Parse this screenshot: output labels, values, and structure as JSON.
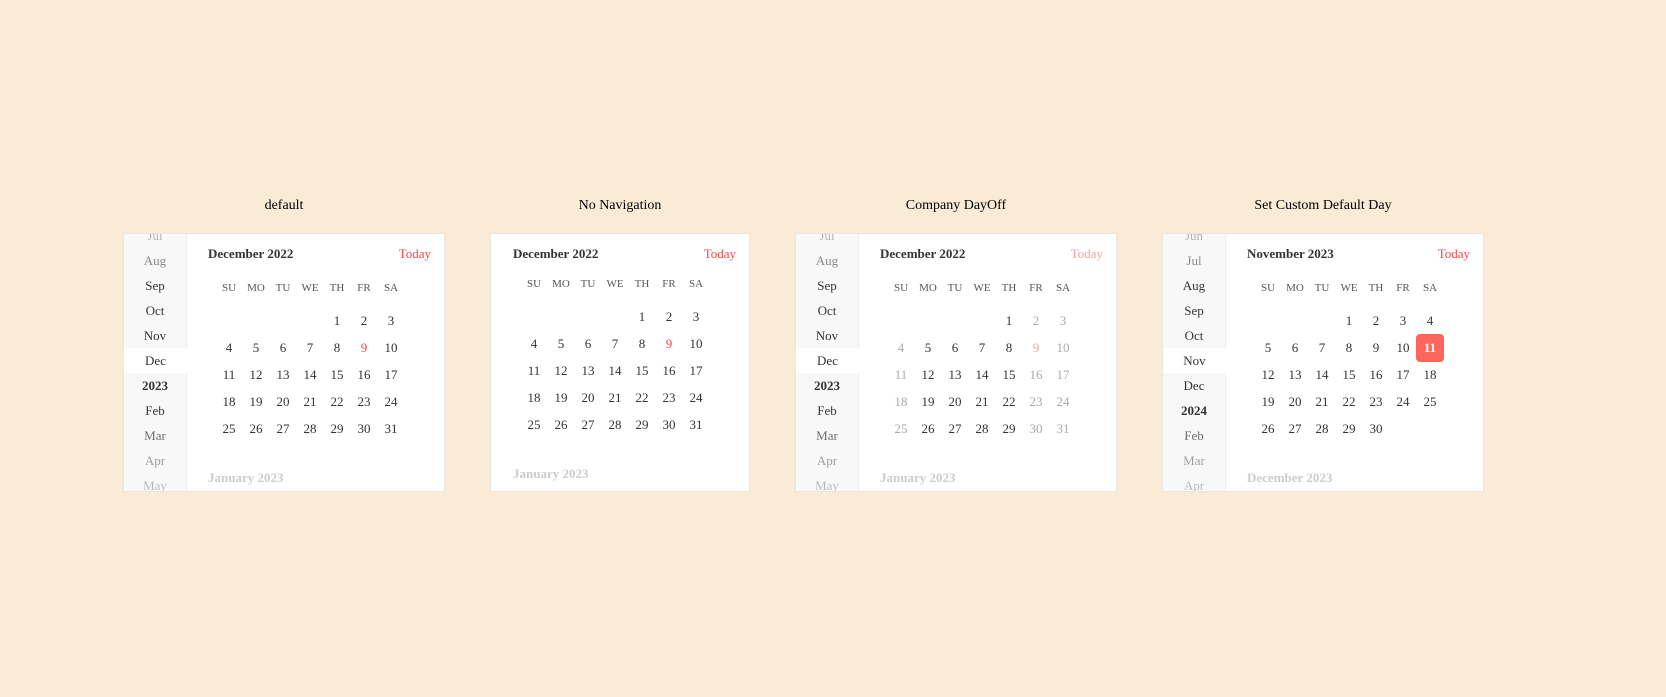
{
  "weekdays": [
    "SU",
    "MO",
    "TU",
    "WE",
    "TH",
    "FR",
    "SA"
  ],
  "colors": {
    "background": "#faebd7",
    "accent": "#ff4444",
    "selected_bg": "#ff665b"
  },
  "calendars": [
    {
      "title": "default",
      "has_sidebar": true,
      "sidebar": [
        "Jul",
        "Aug",
        "Sep",
        "Oct",
        "Nov",
        "Dec",
        "2023",
        "Feb",
        "Mar",
        "Apr",
        "May"
      ],
      "sidebar_selected": 5,
      "sidebar_years": [
        6
      ],
      "month_label": "December 2022",
      "today_label": "Today",
      "today_faded": false,
      "first_weekday": 4,
      "days_in_month": 31,
      "red_days": [
        9
      ],
      "off_days": [],
      "offred_days": [],
      "selected_day": null,
      "next_month_label": "January 2023"
    },
    {
      "title": "No Navigation",
      "has_sidebar": false,
      "sidebar": [],
      "sidebar_selected": null,
      "sidebar_years": [],
      "month_label": "December 2022",
      "today_label": "Today",
      "today_faded": false,
      "first_weekday": 4,
      "days_in_month": 31,
      "red_days": [
        9
      ],
      "off_days": [],
      "offred_days": [],
      "selected_day": null,
      "next_month_label": "January 2023"
    },
    {
      "title": "Company DayOff",
      "has_sidebar": true,
      "sidebar": [
        "Jul",
        "Aug",
        "Sep",
        "Oct",
        "Nov",
        "Dec",
        "2023",
        "Feb",
        "Mar",
        "Apr",
        "May"
      ],
      "sidebar_selected": 5,
      "sidebar_years": [
        6
      ],
      "month_label": "December 2022",
      "today_label": "Today",
      "today_faded": true,
      "first_weekday": 4,
      "days_in_month": 31,
      "red_days": [],
      "off_days": [
        2,
        3,
        4,
        10,
        11,
        16,
        17,
        18,
        23,
        24,
        25,
        30,
        31
      ],
      "offred_days": [
        9
      ],
      "selected_day": null,
      "next_month_label": "January 2023"
    },
    {
      "title": "Set Custom Default Day",
      "has_sidebar": true,
      "sidebar": [
        "Jun",
        "Jul",
        "Aug",
        "Sep",
        "Oct",
        "Nov",
        "Dec",
        "2024",
        "Feb",
        "Mar",
        "Apr"
      ],
      "sidebar_selected": 5,
      "sidebar_years": [
        7
      ],
      "month_label": "November 2023",
      "today_label": "Today",
      "today_faded": false,
      "first_weekday": 3,
      "days_in_month": 30,
      "red_days": [],
      "off_days": [],
      "offred_days": [],
      "selected_day": 11,
      "next_month_label": "December 2023"
    }
  ]
}
